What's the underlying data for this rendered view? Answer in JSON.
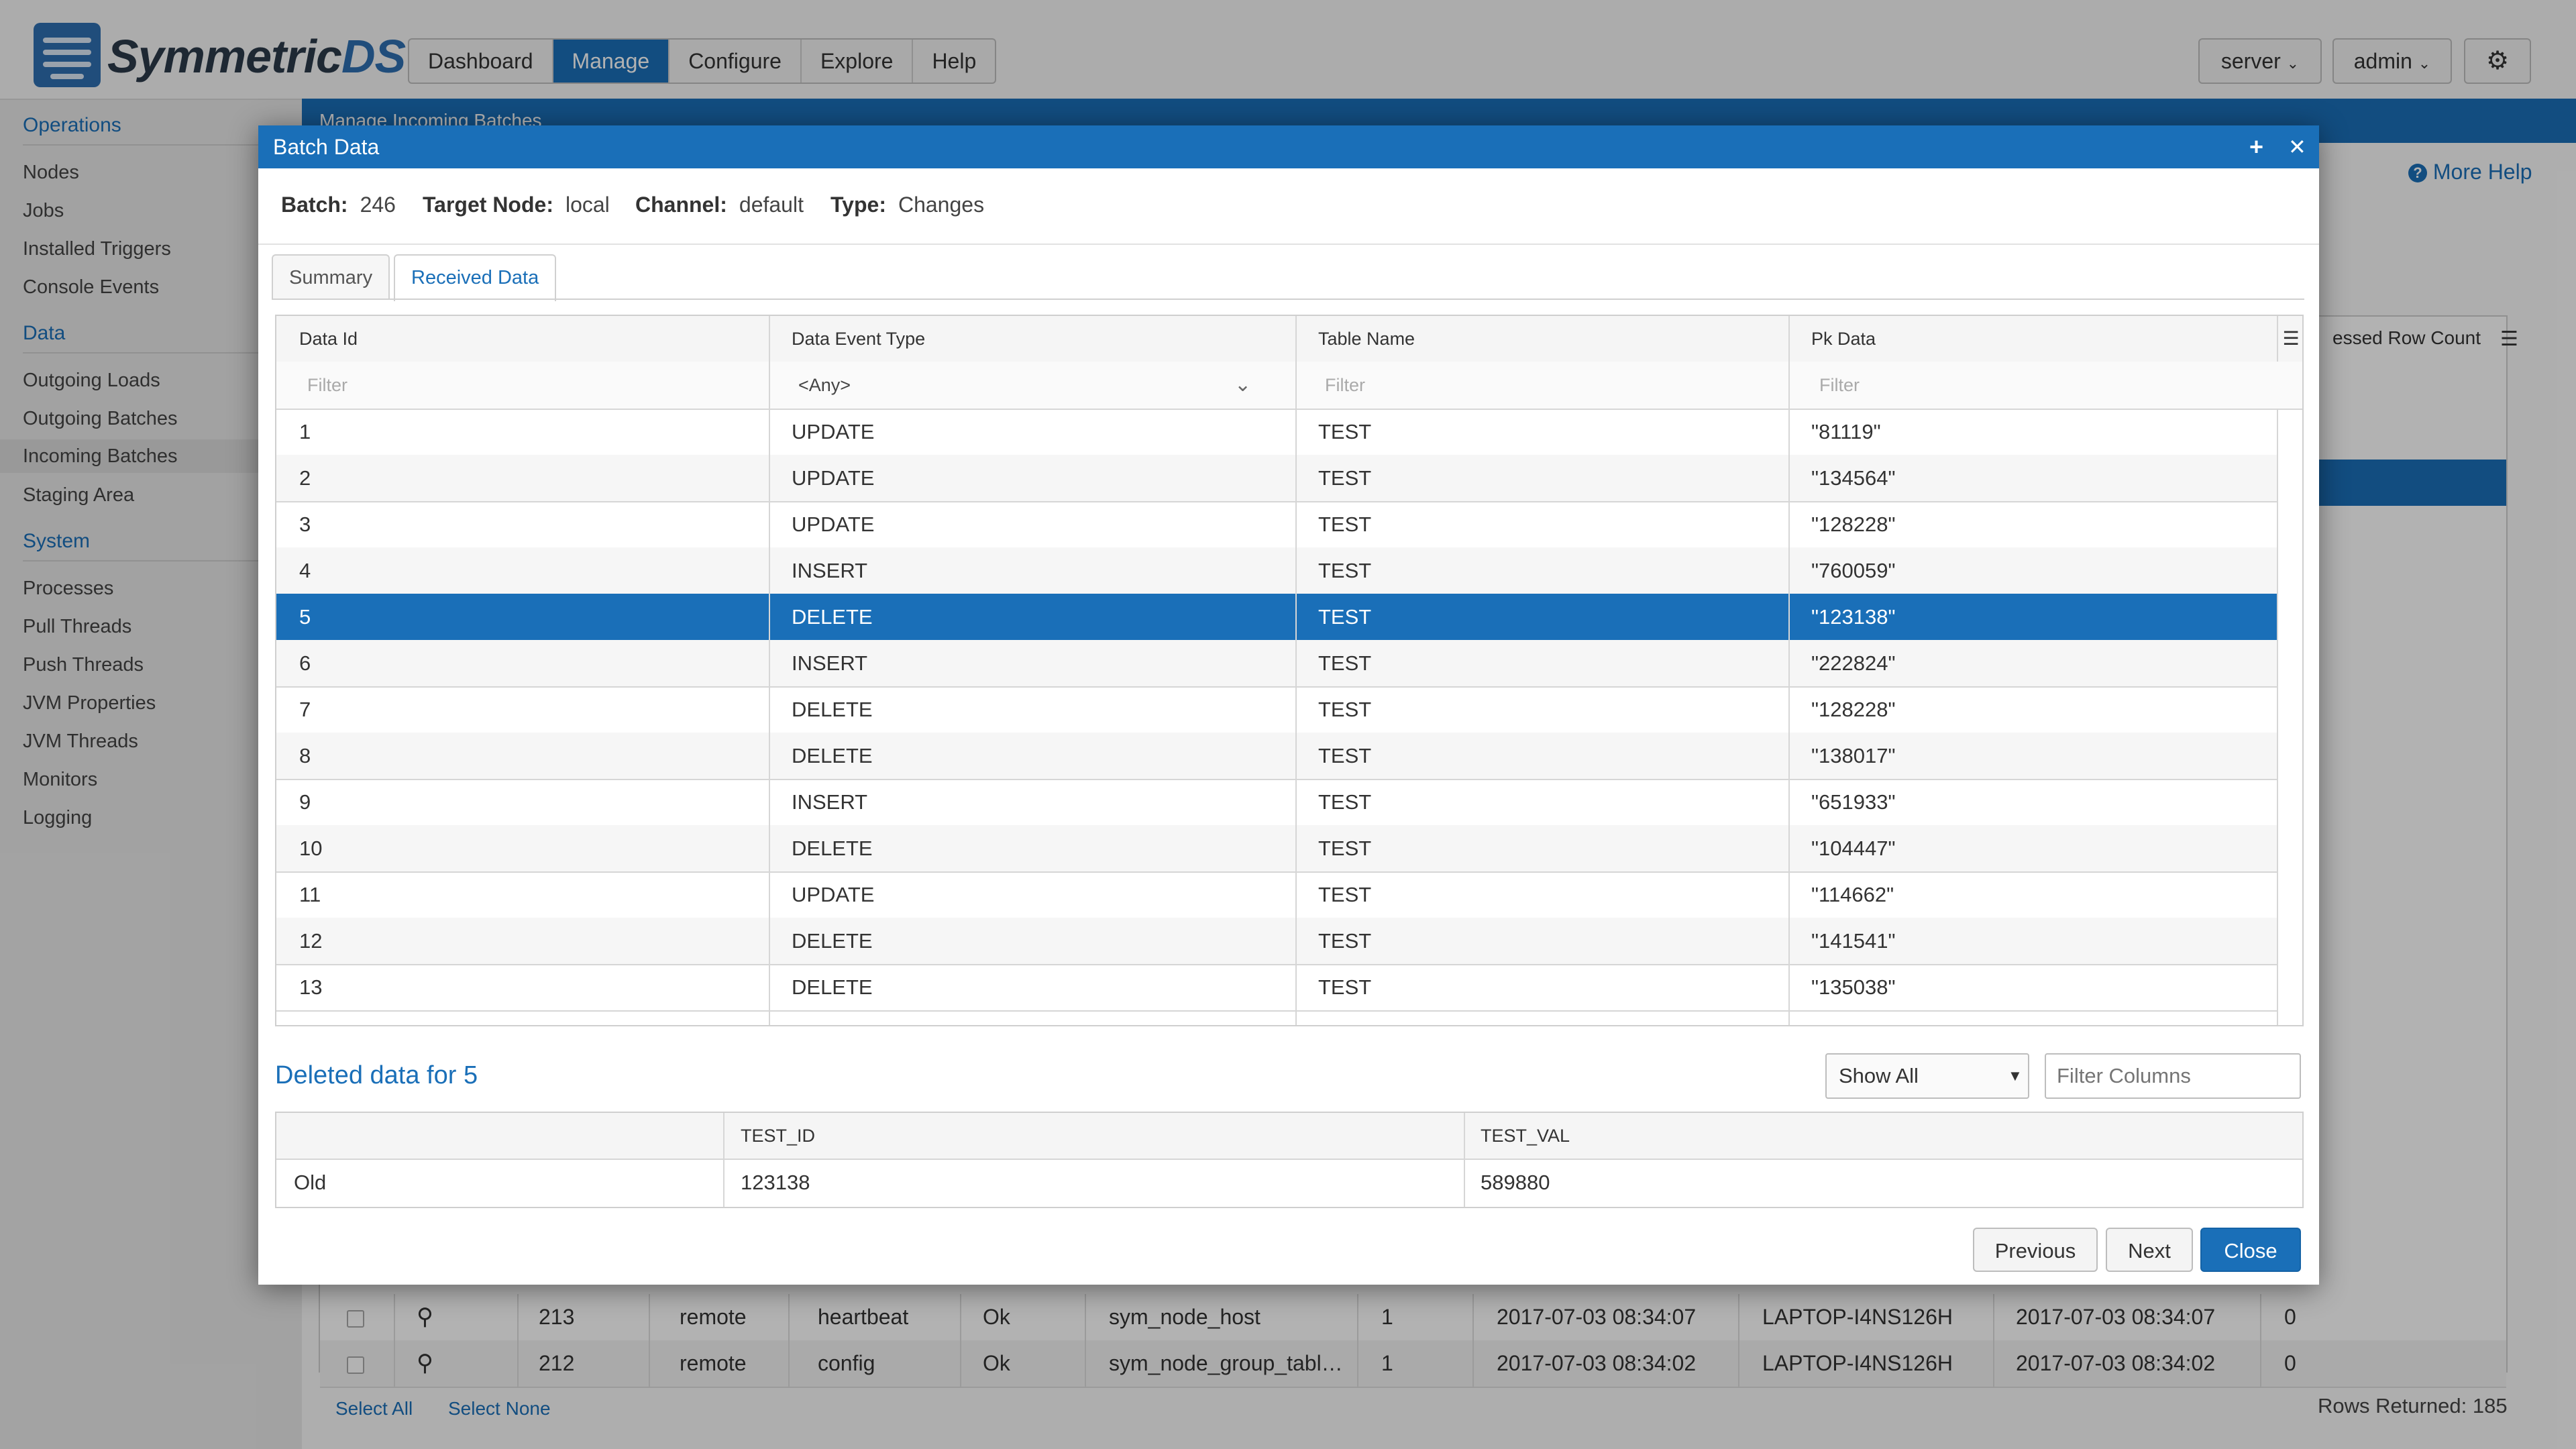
{
  "app": {
    "logo_text": "Symmetric",
    "logo_text_ds": "DS"
  },
  "nav": {
    "items": [
      "Dashboard",
      "Manage",
      "Configure",
      "Explore",
      "Help"
    ],
    "active": "Manage"
  },
  "header": {
    "server_label": "server",
    "admin_label": "admin"
  },
  "sidebar": {
    "sections": [
      {
        "title": "Operations",
        "items": [
          "Nodes",
          "Jobs",
          "Installed Triggers",
          "Console Events"
        ]
      },
      {
        "title": "Data",
        "items": [
          "Outgoing Loads",
          "Outgoing Batches",
          "Incoming Batches",
          "Staging Area"
        ]
      },
      {
        "title": "System",
        "items": [
          "Processes",
          "Pull Threads",
          "Push Threads",
          "JVM Properties",
          "JVM Threads",
          "Monitors",
          "Logging"
        ]
      }
    ],
    "active_item": "Incoming Batches"
  },
  "background": {
    "panel_title": "Manage Incoming Batches",
    "more_help": "More Help",
    "partial_header": "essed Row Count",
    "rows": [
      {
        "id": "213",
        "node": "remote",
        "channel": "heartbeat",
        "status": "Ok",
        "table": "sym_node_host",
        "count": "1",
        "created": "2017-07-03 08:34:07",
        "host": "LAPTOP-I4NS126H",
        "last": "2017-07-03 08:34:07",
        "rows": "0"
      },
      {
        "id": "212",
        "node": "remote",
        "channel": "config",
        "status": "Ok",
        "table": "sym_node_group_tabl…",
        "count": "1",
        "created": "2017-07-03 08:34:02",
        "host": "LAPTOP-I4NS126H",
        "last": "2017-07-03 08:34:02",
        "rows": "0"
      }
    ],
    "select_all": "Select All",
    "select_none": "Select None",
    "rows_returned": "Rows Returned: 185"
  },
  "modal": {
    "title": "Batch Data",
    "meta": [
      {
        "label": "Batch:",
        "value": "246"
      },
      {
        "label": "Target Node:",
        "value": "local"
      },
      {
        "label": "Channel:",
        "value": "default"
      },
      {
        "label": "Type:",
        "value": "Changes"
      }
    ],
    "tabs": [
      "Summary",
      "Received Data"
    ],
    "active_tab": "Received Data",
    "grid": {
      "columns": [
        "Data Id",
        "Data Event Type",
        "Table Name",
        "Pk Data"
      ],
      "filter_placeholder": "Filter",
      "event_type_filter": "<Any>",
      "selected_row": 4,
      "rows": [
        [
          "1",
          "UPDATE",
          "TEST",
          "\"81119\""
        ],
        [
          "2",
          "UPDATE",
          "TEST",
          "\"134564\""
        ],
        [
          "3",
          "UPDATE",
          "TEST",
          "\"128228\""
        ],
        [
          "4",
          "INSERT",
          "TEST",
          "\"760059\""
        ],
        [
          "5",
          "DELETE",
          "TEST",
          "\"123138\""
        ],
        [
          "6",
          "INSERT",
          "TEST",
          "\"222824\""
        ],
        [
          "7",
          "DELETE",
          "TEST",
          "\"128228\""
        ],
        [
          "8",
          "DELETE",
          "TEST",
          "\"138017\""
        ],
        [
          "9",
          "INSERT",
          "TEST",
          "\"651933\""
        ],
        [
          "10",
          "DELETE",
          "TEST",
          "\"104447\""
        ],
        [
          "11",
          "UPDATE",
          "TEST",
          "\"114662\""
        ],
        [
          "12",
          "DELETE",
          "TEST",
          "\"141541\""
        ],
        [
          "13",
          "DELETE",
          "TEST",
          "\"135038\""
        ]
      ]
    },
    "deleted": {
      "title": "Deleted data for 5",
      "show_all": "Show All",
      "filter_columns_placeholder": "Filter Columns",
      "columns": [
        "",
        "TEST_ID",
        "TEST_VAL"
      ],
      "row": [
        "Old",
        "123138",
        "589880"
      ]
    },
    "buttons": {
      "previous": "Previous",
      "next": "Next",
      "close": "Close"
    }
  },
  "colors": {
    "accent": "#1a6fb8",
    "selected_row": "#1a6fb8"
  }
}
